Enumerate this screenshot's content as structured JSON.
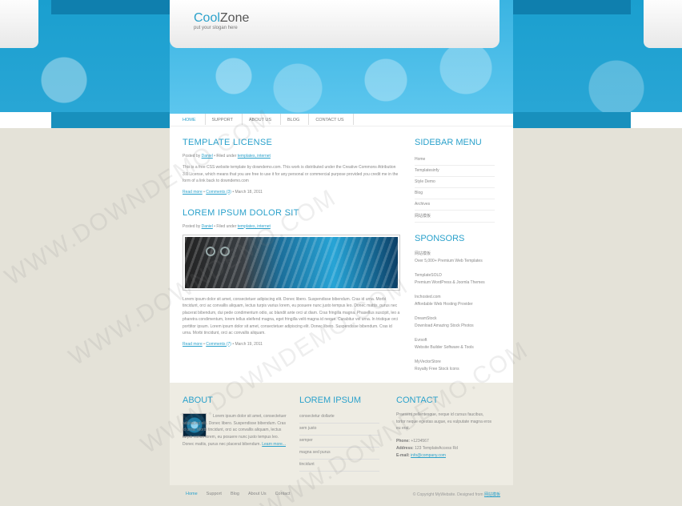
{
  "header": {
    "logo_part1": "Cool",
    "logo_part2": "Zone",
    "slogan": "put your slogan here"
  },
  "nav": {
    "items": [
      "HOME",
      "SUPPORT",
      "ABOUT US",
      "BLOG",
      "CONTACT US"
    ],
    "active": "HOME"
  },
  "posts": [
    {
      "title": "TEMPLATE LICENSE",
      "meta_prefix": "Posted by",
      "author": "Daniel",
      "filed_under": "Filed under",
      "tags": "templates, internet",
      "body": "This is a free CSS website template by downdemo.com. This work is distributed under the Creative Commons Attribution 3.0 License, which means that you are free to use it for any personal or commercial purpose provided you credit me in the form of a link back to downdemo.com",
      "read_more": "Read more",
      "comments": "Comments (3)",
      "date": "March 18, 2011"
    },
    {
      "title": "LOREM IPSUM DOLOR SIT",
      "meta_prefix": "Posted by",
      "author": "Daniel",
      "filed_under": "Filed under",
      "tags": "templates, internet",
      "body": "Lorem ipsum dolor sit amet, consectetuer adipiscing elit. Donec libero. Suspendisse bibendum. Cras id urna. Morbi tincidunt, orci ac convallis aliquam, lectus turpis varius lorem, eu posuere nunc justo tempus leo. Donec mattis, purus nec placerat bibendum, dui pede condimentum odio, ac blandit ante orci ut diam. Cras fringilla magna. Phasellus suscipit, leo a pharetra condimentum, lorem tellus eleifend magna, eget fringilla velit magna id neque. Curabitur vel urna. In tristique orci porttitor ipsum. Lorem ipsum dolor sit amet, consectetuer adipiscing elit. Donec libero. Suspendisse bibendum. Cras id urna. Morbi tincidunt, orci ac convallis aliquam.",
      "read_more": "Read more",
      "comments": "Comments (7)",
      "date": "March 19, 2011"
    }
  ],
  "sidebar": {
    "menu_title": "SIDEBAR MENU",
    "menu_items": [
      "Home",
      "Templatesinfy",
      "Style Demo",
      "Blog",
      "Archives",
      "网站模板"
    ],
    "sponsors_title": "SPONSORS",
    "sponsors": [
      {
        "name": "网站模板",
        "desc": "Over 5,000+ Premium Web Templates"
      },
      {
        "name": "TemplateSOLD",
        "desc": "Premium WordPress & Joomla Themes"
      },
      {
        "name": "Inchosted.com",
        "desc": "Affordable Web Hosting Provider"
      },
      {
        "name": "DreamStock",
        "desc": "Download Amazing Stock Photos"
      },
      {
        "name": "Evrsoft",
        "desc": "Website Builder Software & Tools"
      },
      {
        "name": "MyVectorStore",
        "desc": "Royalty Free Stock Icons"
      }
    ]
  },
  "footer": {
    "about_title": "ABOUT",
    "about_text": "Lorem ipsum dolor sit amet, consectetuer adipiscing elit. Donec libero. Suspendisse bibendum. Cras id urna. Morbi tincidunt, orci ac convallis aliquam, lectus turpis varius lorem, eu posuere nunc justo tempus leo. Donec mattis, purus nec placerat bibendum.",
    "about_link": "Learn more...",
    "lorem_title": "LOREM IPSUM",
    "lorem_items": [
      "consectetur dollarte",
      "sem justo",
      "semper",
      "magna sed purus",
      "tincidunt"
    ],
    "contact_title": "CONTACT",
    "contact_text": "Praesent pellentesque, neque id cursus faucibus, tortor neque egestas augue, eu vulputate magna eros eu erat.",
    "phone_label": "Phone:",
    "phone": "+1234567",
    "address_label": "Address:",
    "address": "123 TemplateAccess Rd",
    "email_label": "E-mail:",
    "email": "info@company.com"
  },
  "bottom": {
    "nav": [
      "Home",
      "Support",
      "Blog",
      "About Us",
      "Contact"
    ],
    "active": "Home",
    "copyright": "© Copyright MyWebsite. Designed from",
    "copyright_link": "网站模板"
  },
  "watermark": "WWW.DOWNDEMO.COM",
  "colors": {
    "accent": "#2aa1cb",
    "header_blue": "#1a9fcf",
    "page_bg": "#e4e2d8"
  }
}
